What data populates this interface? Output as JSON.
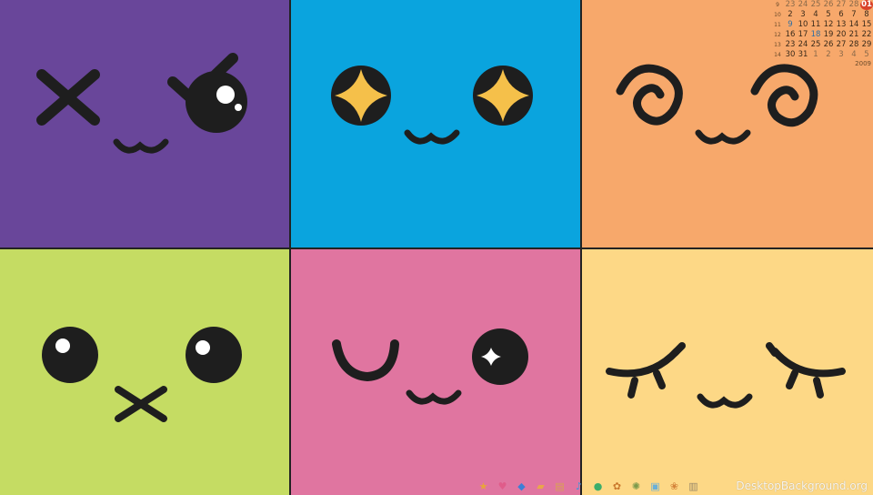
{
  "wallpaper": {
    "tiles": [
      {
        "face": "wink-x-eye",
        "color": "#69469a"
      },
      {
        "face": "sparkle-eyes",
        "color": "#0aa4de"
      },
      {
        "face": "spiral-eyes",
        "color": "#f7a86b"
      },
      {
        "face": "round-eyes-x-mouth",
        "color": "#c5dc63"
      },
      {
        "face": "wink-smile",
        "color": "#e075a0"
      },
      {
        "face": "sleepy-eyes",
        "color": "#fdd886"
      }
    ],
    "ink": "#1e1e1e",
    "star": "#f5c04a"
  },
  "calendar": {
    "weeks": [
      "9",
      "10",
      "11",
      "12",
      "13",
      "14"
    ],
    "rows": [
      [
        "23",
        "24",
        "25",
        "26",
        "27",
        "28",
        "01"
      ],
      [
        "2",
        "3",
        "4",
        "5",
        "6",
        "7",
        "8"
      ],
      [
        "9",
        "10",
        "11",
        "12",
        "13",
        "14",
        "15"
      ],
      [
        "16",
        "17",
        "18",
        "19",
        "20",
        "21",
        "22"
      ],
      [
        "23",
        "24",
        "25",
        "26",
        "27",
        "28",
        "29"
      ],
      [
        "30",
        "31",
        "1",
        "2",
        "3",
        "4",
        "5"
      ]
    ],
    "year": "2009"
  },
  "dock": {
    "items": [
      {
        "icon": "star-icon",
        "glyph": "★",
        "color": "#e8a53a"
      },
      {
        "icon": "heart-icon",
        "glyph": "♥",
        "color": "#e05c8a"
      },
      {
        "icon": "blue-app-icon",
        "glyph": "◆",
        "color": "#3d7fd6"
      },
      {
        "icon": "folder-icon",
        "glyph": "▰",
        "color": "#e9a64a"
      },
      {
        "icon": "document-icon",
        "glyph": "▤",
        "color": "#d9a34f"
      },
      {
        "icon": "music-icon",
        "glyph": "♪",
        "color": "#3b98d8"
      },
      {
        "icon": "globe-icon",
        "glyph": "●",
        "color": "#3cae6b"
      },
      {
        "icon": "pet-icon",
        "glyph": "✿",
        "color": "#c9782c"
      },
      {
        "icon": "gear-icon",
        "glyph": "✺",
        "color": "#7c9a4b"
      },
      {
        "icon": "window-icon",
        "glyph": "▣",
        "color": "#6ab0d8"
      },
      {
        "icon": "flower-icon",
        "glyph": "❀",
        "color": "#d4833a"
      },
      {
        "icon": "trash-icon",
        "glyph": "▥",
        "color": "#9a8a6a"
      }
    ]
  },
  "watermark": "DesktopBackground.org"
}
